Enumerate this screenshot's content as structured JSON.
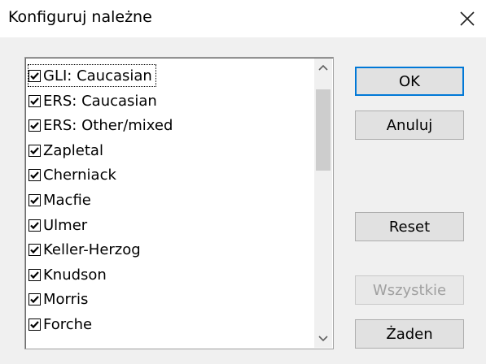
{
  "dialog": {
    "title": "Konfiguruj należne",
    "close_icon": "close-icon"
  },
  "list": {
    "items": [
      {
        "label": "GLI: Caucasian",
        "checked": true,
        "focused": true
      },
      {
        "label": "ERS: Caucasian",
        "checked": true
      },
      {
        "label": "ERS: Other/mixed",
        "checked": true
      },
      {
        "label": "Zapletal",
        "checked": true
      },
      {
        "label": "Cherniack",
        "checked": true
      },
      {
        "label": "Macfie",
        "checked": true
      },
      {
        "label": "Ulmer",
        "checked": true
      },
      {
        "label": "Keller-Herzog",
        "checked": true
      },
      {
        "label": "Knudson",
        "checked": true
      },
      {
        "label": "Morris",
        "checked": true
      },
      {
        "label": "Forche",
        "checked": true
      }
    ]
  },
  "buttons": {
    "ok": "OK",
    "cancel": "Anuluj",
    "reset": "Reset",
    "all": "Wszystkie",
    "none": "Żaden"
  },
  "colors": {
    "accent": "#0078d7",
    "disabled_text": "#a0a0a0"
  }
}
